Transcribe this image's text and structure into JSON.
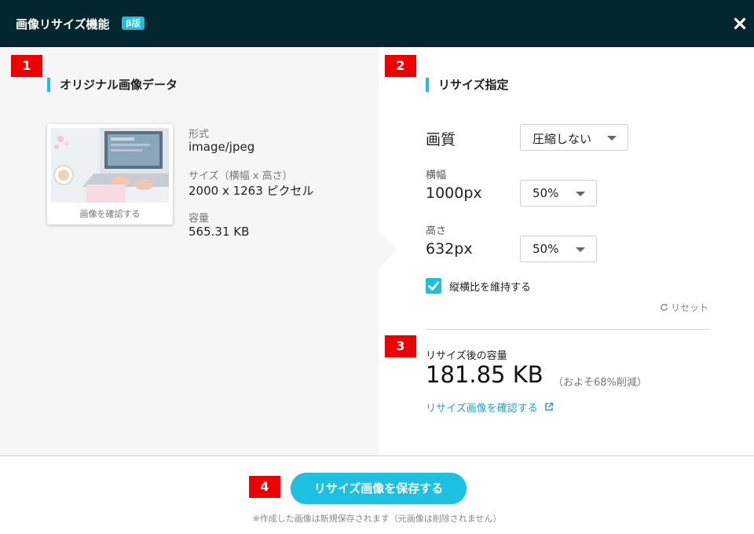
{
  "header": {
    "title": "画像リサイズ機能",
    "beta_badge": "β版",
    "close_icon": "close-icon"
  },
  "steps": [
    "1",
    "2",
    "3",
    "4"
  ],
  "original": {
    "section_title": "オリジナル画像データ",
    "thumbnail_caption": "画像を確認する",
    "format_label": "形式",
    "format_value": "image/jpeg",
    "size_label": "サイズ（横幅 x 高さ）",
    "size_value": "2000 x 1263 ピクセル",
    "filesize_label": "容量",
    "filesize_value": "565.31 KB"
  },
  "resize": {
    "section_title": "リサイズ指定",
    "quality_label": "画質",
    "quality_selected": "圧縮しない",
    "width_label": "横幅",
    "width_value": "1000px",
    "width_selected": "50%",
    "height_label": "高さ",
    "height_value": "632px",
    "height_selected": "50%",
    "keep_ratio_label": "縦横比を維持する",
    "keep_ratio_checked": true,
    "reset_label": "リセット"
  },
  "result": {
    "label": "リサイズ後の容量",
    "value": "181.85 KB",
    "note": "（およそ68%削減）",
    "confirm_link": "リサイズ画像を確認する"
  },
  "footer": {
    "save_button": "リサイズ画像を保存する",
    "note": "※作成した画像は新規保存されます（元画像は削除されません）"
  },
  "colors": {
    "header_bg": "#03272e",
    "accent": "#1ec0e0",
    "step_badge": "#ee0000",
    "left_panel_bg": "#f6f6f6"
  }
}
